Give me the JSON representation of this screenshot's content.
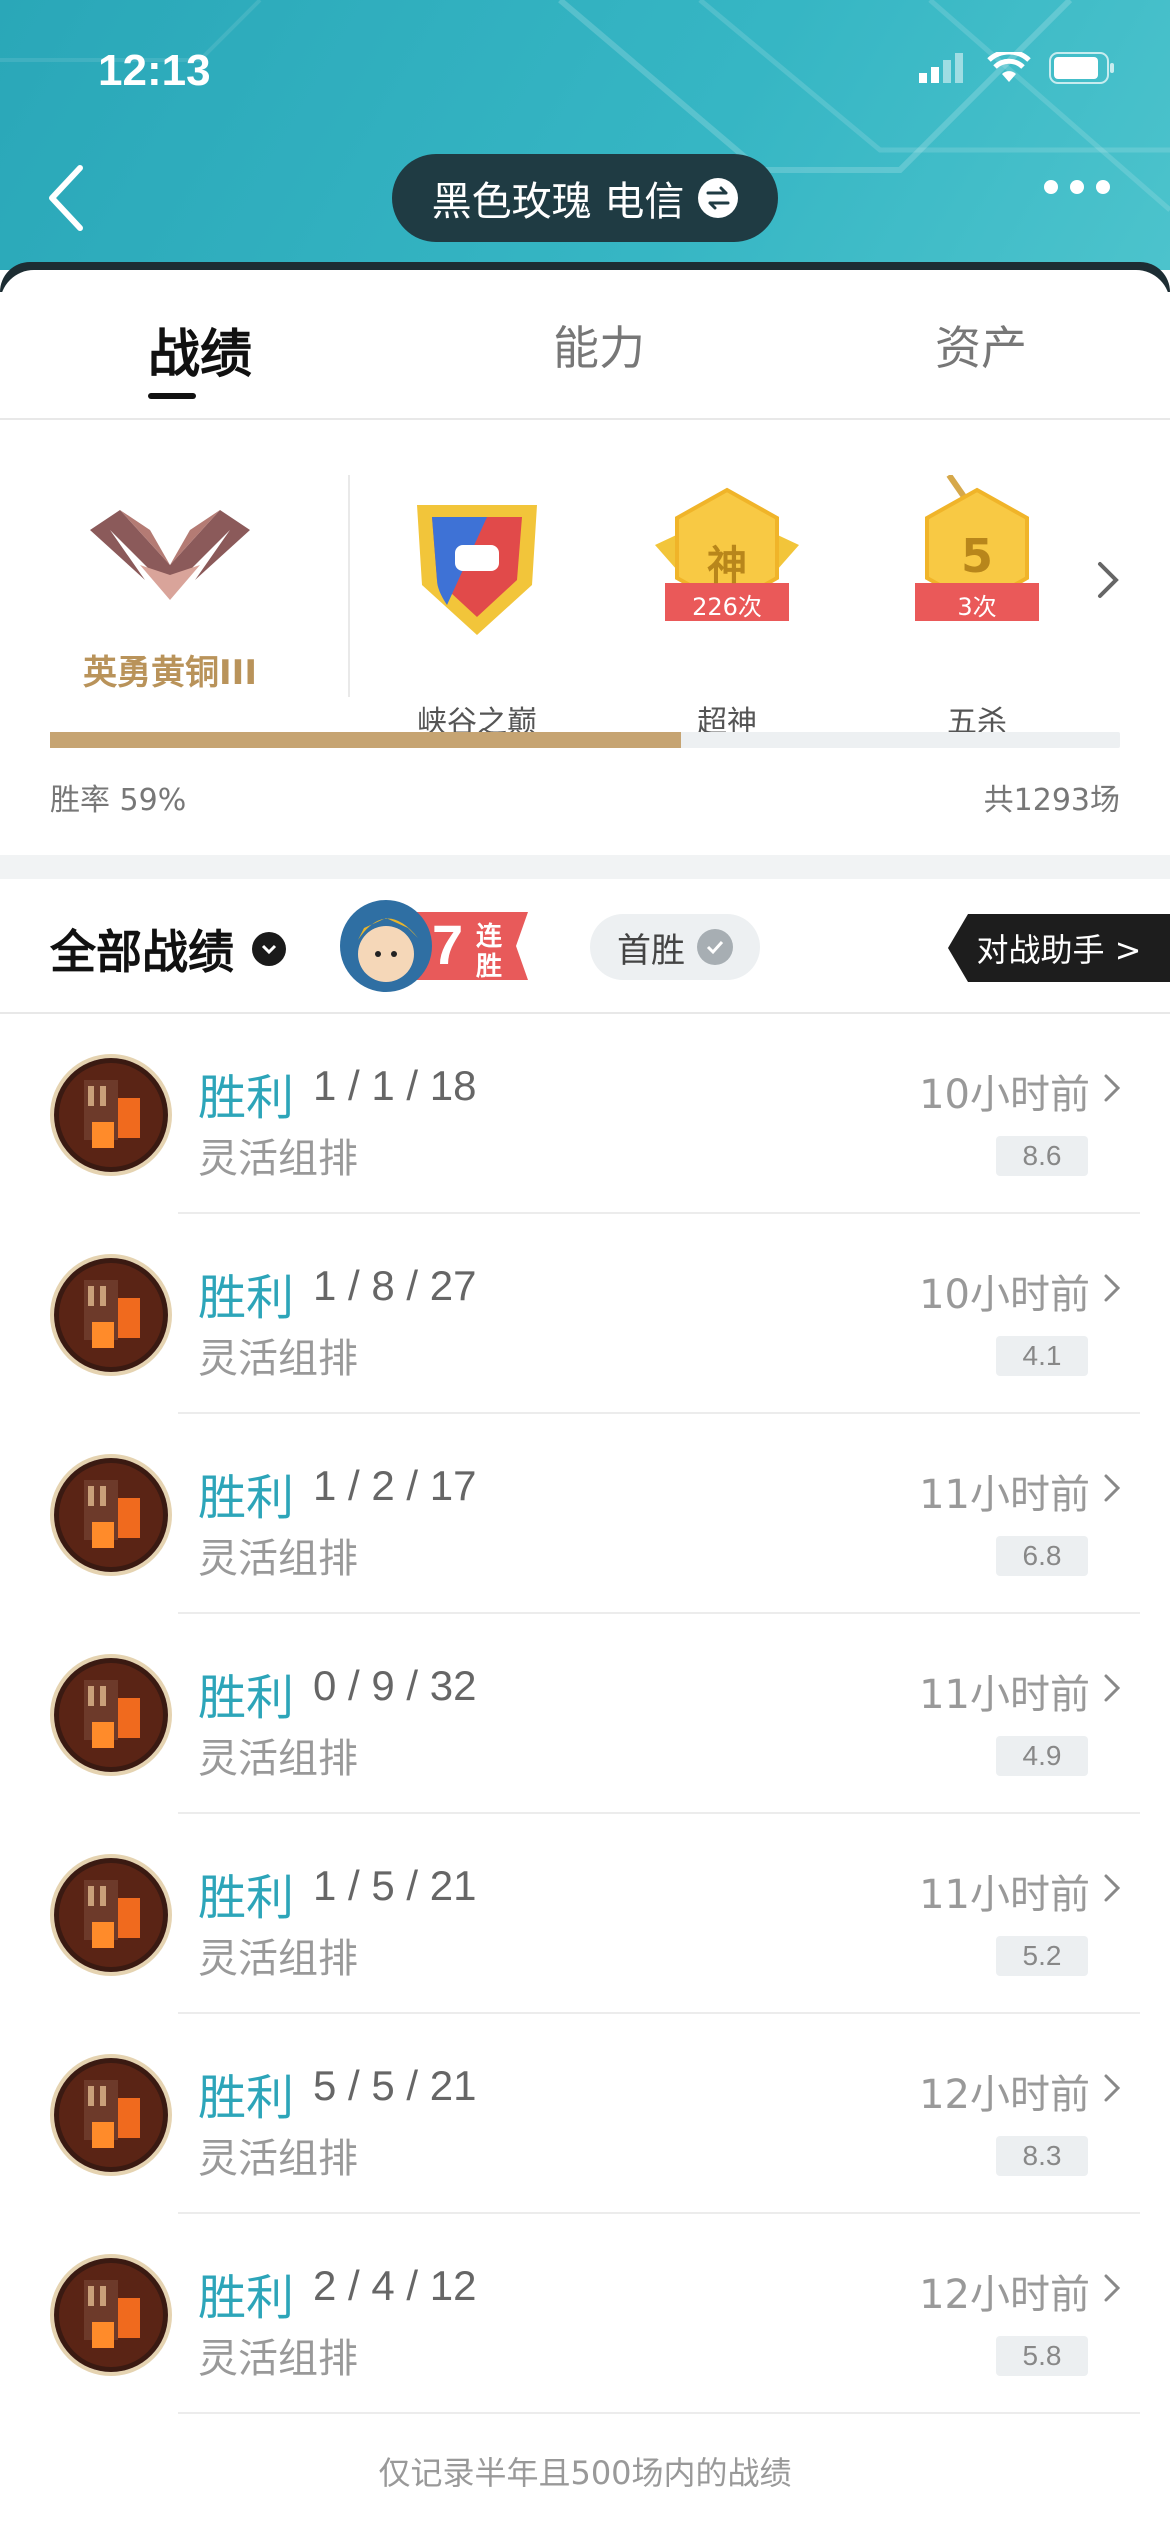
{
  "status_bar": {
    "time": "12:13"
  },
  "header": {
    "player_name": "黑色玫瑰 电信"
  },
  "tabs": [
    {
      "label": "战绩"
    },
    {
      "label": "能力"
    },
    {
      "label": "资产"
    }
  ],
  "honors": {
    "rank": "英勇黄铜III",
    "badges": [
      {
        "label": "峡谷之巅",
        "count": ""
      },
      {
        "label": "超神",
        "count": "226次",
        "glyph": "神"
      },
      {
        "label": "五杀",
        "count": "3次",
        "glyph": "5"
      }
    ],
    "win_rate_text": "胜率 59%",
    "win_rate": 0.59,
    "total_text": "共1293场"
  },
  "filter": {
    "title": "全部战绩",
    "streak_number": "7",
    "streak_text_1": "连",
    "streak_text_2": "胜",
    "first_win": "首胜",
    "assistant": "对战助手 >"
  },
  "matches": [
    {
      "result": "胜利",
      "kda": "1 / 1 / 18",
      "mode": "灵活组排",
      "time": "10小时前",
      "score": "8.6"
    },
    {
      "result": "胜利",
      "kda": "1 / 8 / 27",
      "mode": "灵活组排",
      "time": "10小时前",
      "score": "4.1"
    },
    {
      "result": "胜利",
      "kda": "1 / 2 / 17",
      "mode": "灵活组排",
      "time": "11小时前",
      "score": "6.8"
    },
    {
      "result": "胜利",
      "kda": "0 / 9 / 32",
      "mode": "灵活组排",
      "time": "11小时前",
      "score": "4.9"
    },
    {
      "result": "胜利",
      "kda": "1 / 5 / 21",
      "mode": "灵活组排",
      "time": "11小时前",
      "score": "5.2"
    },
    {
      "result": "胜利",
      "kda": "5 / 5 / 21",
      "mode": "灵活组排",
      "time": "12小时前",
      "score": "8.3"
    },
    {
      "result": "胜利",
      "kda": "2 / 4 / 12",
      "mode": "灵活组排",
      "time": "12小时前",
      "score": "5.8"
    }
  ],
  "footer_note": "仅记录半年且500场内的战绩",
  "colors": {
    "accent": "#2da5b9",
    "header": "#36b6c4",
    "rank_gold": "#b9935a",
    "progress": "#c6a472"
  }
}
